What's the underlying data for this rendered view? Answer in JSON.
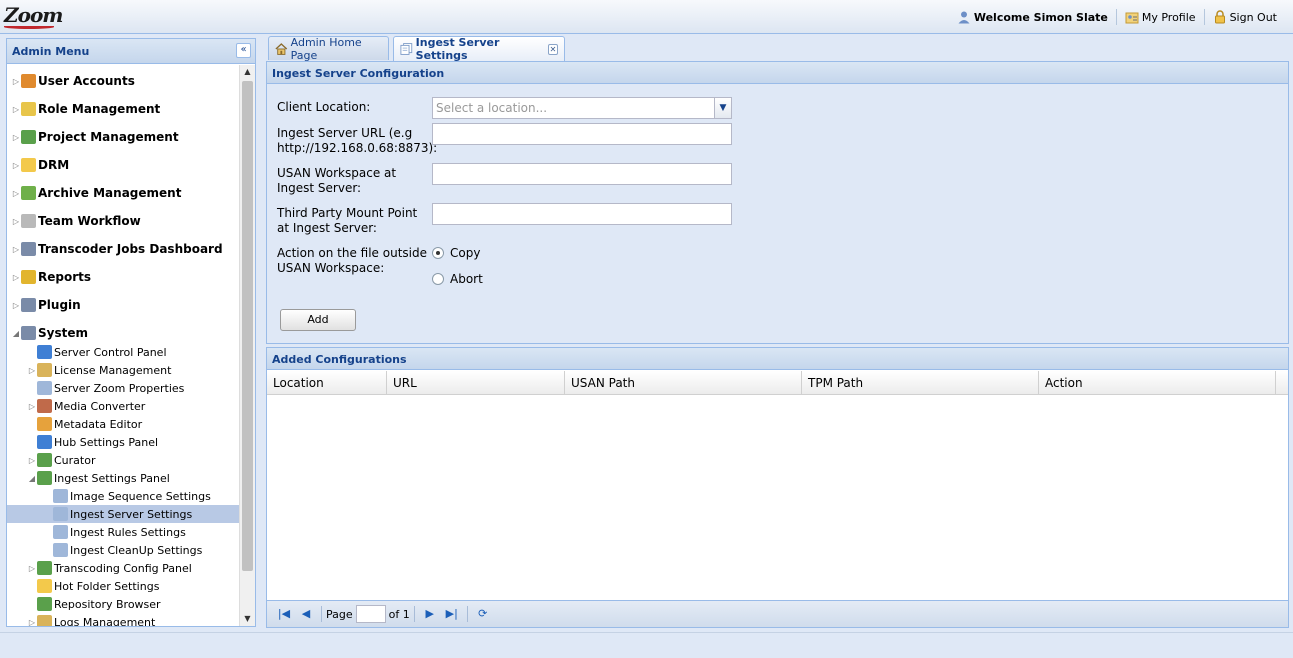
{
  "app": {
    "logo_text": "Zoom"
  },
  "header": {
    "welcome": "Welcome Simon Slate",
    "my_profile": "My Profile",
    "sign_out": "Sign Out"
  },
  "admin_menu": {
    "title": "Admin Menu",
    "top_items": [
      {
        "label": "User Accounts",
        "icon": "user-icon",
        "color": "#e08a2e"
      },
      {
        "label": "Role Management",
        "icon": "shield-icon",
        "color": "#e8c54a"
      },
      {
        "label": "Project Management",
        "icon": "pie-chart-icon",
        "color": "#5aa04b"
      },
      {
        "label": "DRM",
        "icon": "folder-icon",
        "color": "#f3c94b"
      },
      {
        "label": "Archive Management",
        "icon": "archive-icon",
        "color": "#6fb04a"
      },
      {
        "label": "Team Workflow",
        "icon": "team-icon",
        "color": "#b9b9b9"
      },
      {
        "label": "Transcoder Jobs Dashboard",
        "icon": "monitor-icon",
        "color": "#7a8ba8"
      },
      {
        "label": "Reports",
        "icon": "reports-icon",
        "color": "#e2b52e"
      },
      {
        "label": "Plugin",
        "icon": "plugin-icon",
        "color": "#7a8ba8"
      },
      {
        "label": "System",
        "icon": "system-icon",
        "color": "#7a8ba8"
      }
    ],
    "system_children": [
      {
        "label": "Server Control Panel",
        "icon": "monitor-icon",
        "color": "#3f7fd4",
        "expandable": false
      },
      {
        "label": "License Management",
        "icon": "license-icon",
        "color": "#d9b35a",
        "expandable": true
      },
      {
        "label": "Server Zoom Properties",
        "icon": "properties-icon",
        "color": "#9fb7d9",
        "expandable": false
      },
      {
        "label": "Media Converter",
        "icon": "media-converter-icon",
        "color": "#c06a4a",
        "expandable": true
      },
      {
        "label": "Metadata Editor",
        "icon": "metadata-icon",
        "color": "#e6a23c",
        "expandable": false
      },
      {
        "label": "Hub Settings Panel",
        "icon": "monitor-icon",
        "color": "#3f7fd4",
        "expandable": false
      },
      {
        "label": "Curator",
        "icon": "tree-icon",
        "color": "#5aa04b",
        "expandable": true
      },
      {
        "label": "Ingest Settings Panel",
        "icon": "tree-icon",
        "color": "#5aa04b",
        "expandable": true,
        "expanded": true
      }
    ],
    "ingest_children": [
      {
        "label": "Image Sequence Settings",
        "icon": "pages-icon",
        "color": "#9fb7d9"
      },
      {
        "label": "Ingest Server Settings",
        "icon": "pages-icon",
        "color": "#9fb7d9",
        "selected": true
      },
      {
        "label": "Ingest Rules Settings",
        "icon": "pages-icon",
        "color": "#9fb7d9"
      },
      {
        "label": "Ingest CleanUp Settings",
        "icon": "pages-icon",
        "color": "#9fb7d9"
      }
    ],
    "after_children": [
      {
        "label": "Transcoding Config Panel",
        "icon": "tree-icon",
        "color": "#5aa04b",
        "expandable": true
      },
      {
        "label": "Hot Folder Settings",
        "icon": "folder-icon",
        "color": "#f3c94b",
        "expandable": false
      },
      {
        "label": "Repository Browser",
        "icon": "tree-icon",
        "color": "#5aa04b",
        "expandable": false
      },
      {
        "label": "Logs Management",
        "icon": "license-icon",
        "color": "#d9b35a",
        "expandable": true
      }
    ]
  },
  "tabs": [
    {
      "label": "Admin Home Page",
      "icon": "home-icon",
      "active": false
    },
    {
      "label": "Ingest Server Settings",
      "icon": "pages-icon",
      "active": true
    }
  ],
  "config": {
    "title": "Ingest Server Configuration",
    "client_location_label": "Client Location:",
    "client_location_placeholder": "Select a location...",
    "ingest_url_label": "Ingest Server URL (e.g http://192.168.0.68:8873):",
    "ingest_url_value": "",
    "usan_label": "USAN Workspace at Ingest Server:",
    "usan_value": "",
    "tpm_label": "Third Party Mount Point at Ingest Server:",
    "tpm_value": "",
    "action_label": "Action on the file outside USAN Workspace:",
    "option_copy": "Copy",
    "option_abort": "Abort",
    "selected_option": "Copy",
    "add_button": "Add"
  },
  "added": {
    "title": "Added Configurations",
    "columns": [
      "Location",
      "URL",
      "USAN Path",
      "TPM Path",
      "Action"
    ],
    "rows": []
  },
  "pager": {
    "page_label": "Page",
    "page_value": "",
    "of_label": "of 1"
  }
}
